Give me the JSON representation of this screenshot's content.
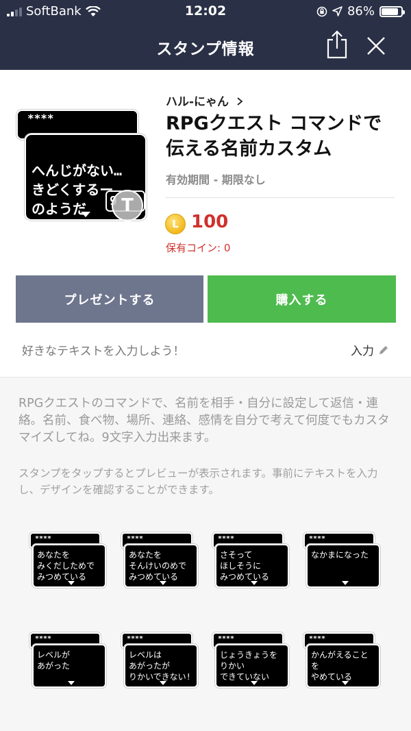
{
  "status_bar": {
    "carrier": "SoftBank",
    "time": "12:02",
    "battery": "86%"
  },
  "header": {
    "title": "スタンプ情報"
  },
  "product": {
    "creator": "ハル-にゃん",
    "title": "RPGクエスト コマンドで伝える名前カスタム",
    "validity": "有効期間 - 期限なし",
    "coin_symbol": "L",
    "price": "100",
    "owned_coins": "保有コイン: 0",
    "main_sticker": {
      "tab_text": "****",
      "lines": "へんじがない…\nきどくするー\nのようだ",
      "count": "9"
    },
    "badge": "T"
  },
  "actions": {
    "present_label": "プレゼントする",
    "buy_label": "購入する"
  },
  "custom_text": {
    "hint": "好きなテキストを入力しよう！",
    "input_label": "入力"
  },
  "description": {
    "text": "RPGクエストのコマンドで、名前を相手・自分に設定して返信・連絡。名前、食べ物、場所、連絡、感情を自分で考えて何度でもカスタマイズしてね。9文字入力出来ます。",
    "preview_note": "スタンプをタップするとプレビューが表示されます。事前にテキストを入力し、デザインを確認することができます。"
  },
  "stickers": [
    {
      "tab": "****",
      "text": "あなたを\nみくだしためで\nみつめている"
    },
    {
      "tab": "****",
      "text": "あなたを\nそんけいのめで\nみつめている"
    },
    {
      "tab": "****",
      "text": "さそって\nほしそうに\nみつめている"
    },
    {
      "tab": "****",
      "text": "なかまになった"
    },
    {
      "tab": "****",
      "text": "レベルが\nあがった"
    },
    {
      "tab": "****",
      "text": "レベルは\nあがったが\nりかいできない!"
    },
    {
      "tab": "****",
      "text": "じょうきょうを\nりかい\nできていない"
    },
    {
      "tab": "****",
      "text": "かんがえることを\nやめている"
    }
  ],
  "colors": {
    "header_bg": "#2a3046",
    "present_button": "#6e768e",
    "buy_button": "#4ebb4e",
    "price": "#d0312d"
  },
  "icons": [
    "wifi-icon",
    "lock-rotation-icon",
    "location-arrow-icon",
    "battery-icon",
    "share-icon",
    "close-icon",
    "chevron-right-icon",
    "pencil-icon",
    "coin-icon"
  ]
}
